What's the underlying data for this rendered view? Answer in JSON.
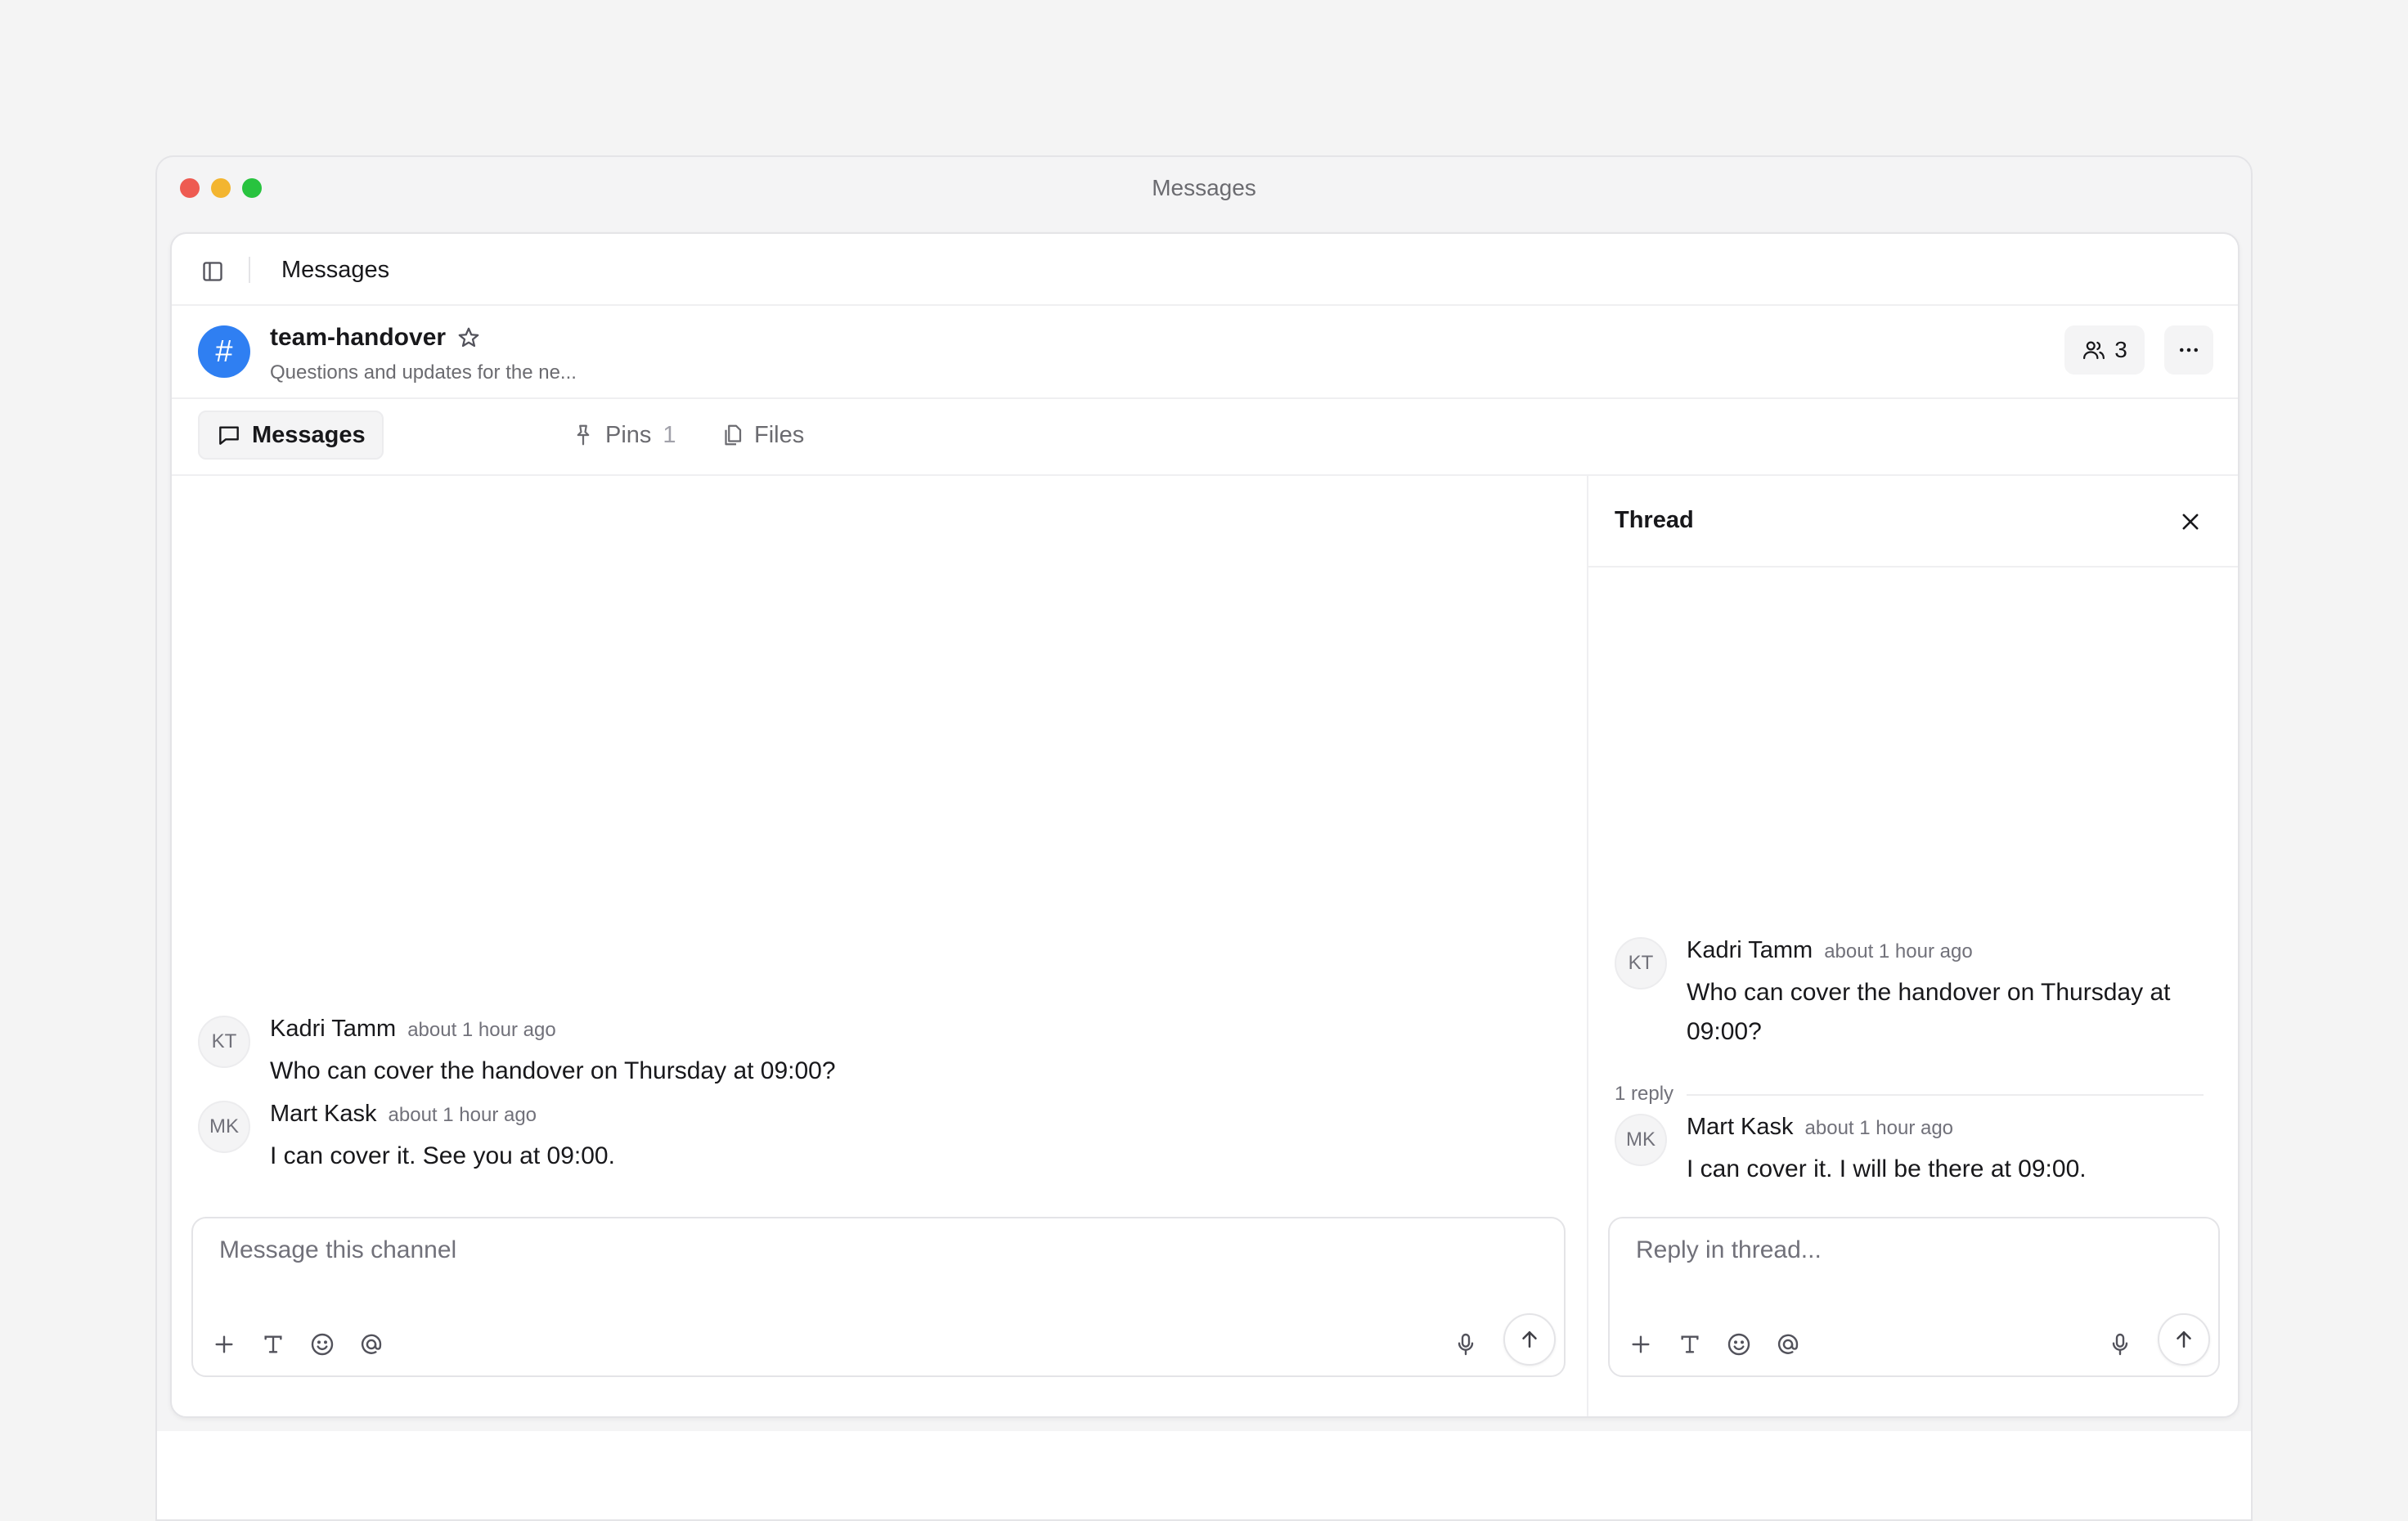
{
  "window": {
    "title": "Messages"
  },
  "topbar": {
    "title": "Messages"
  },
  "channel": {
    "icon_glyph": "#",
    "name": "team-handover",
    "description": "Questions and updates for the ne...",
    "member_count": "3",
    "accent_color": "#2f7ff2"
  },
  "tabs": [
    {
      "label": "Messages",
      "count": ""
    },
    {
      "label": "Pins",
      "count": "1"
    },
    {
      "label": "Files",
      "count": ""
    }
  ],
  "messages": [
    {
      "initials": "KT",
      "author": "Kadri Tamm",
      "time": "about 1 hour ago",
      "text": "Who can cover the handover on Thursday at 09:00?"
    },
    {
      "initials": "MK",
      "author": "Mart Kask",
      "time": "about 1 hour ago",
      "text": "I can cover it. See you at 09:00."
    }
  ],
  "composer": {
    "placeholder": "Message this channel"
  },
  "thread": {
    "title": "Thread",
    "parent": {
      "initials": "KT",
      "author": "Kadri Tamm",
      "time": "about 1 hour ago",
      "text_line1": "Who can cover the handover on Thursday at",
      "text_line2": "09:00?"
    },
    "reply_count_label": "1 reply",
    "replies": [
      {
        "initials": "MK",
        "author": "Mart Kask",
        "time": "about 1 hour ago",
        "text": "I can cover it. I will be there at 09:00."
      }
    ],
    "composer_placeholder": "Reply in thread..."
  }
}
